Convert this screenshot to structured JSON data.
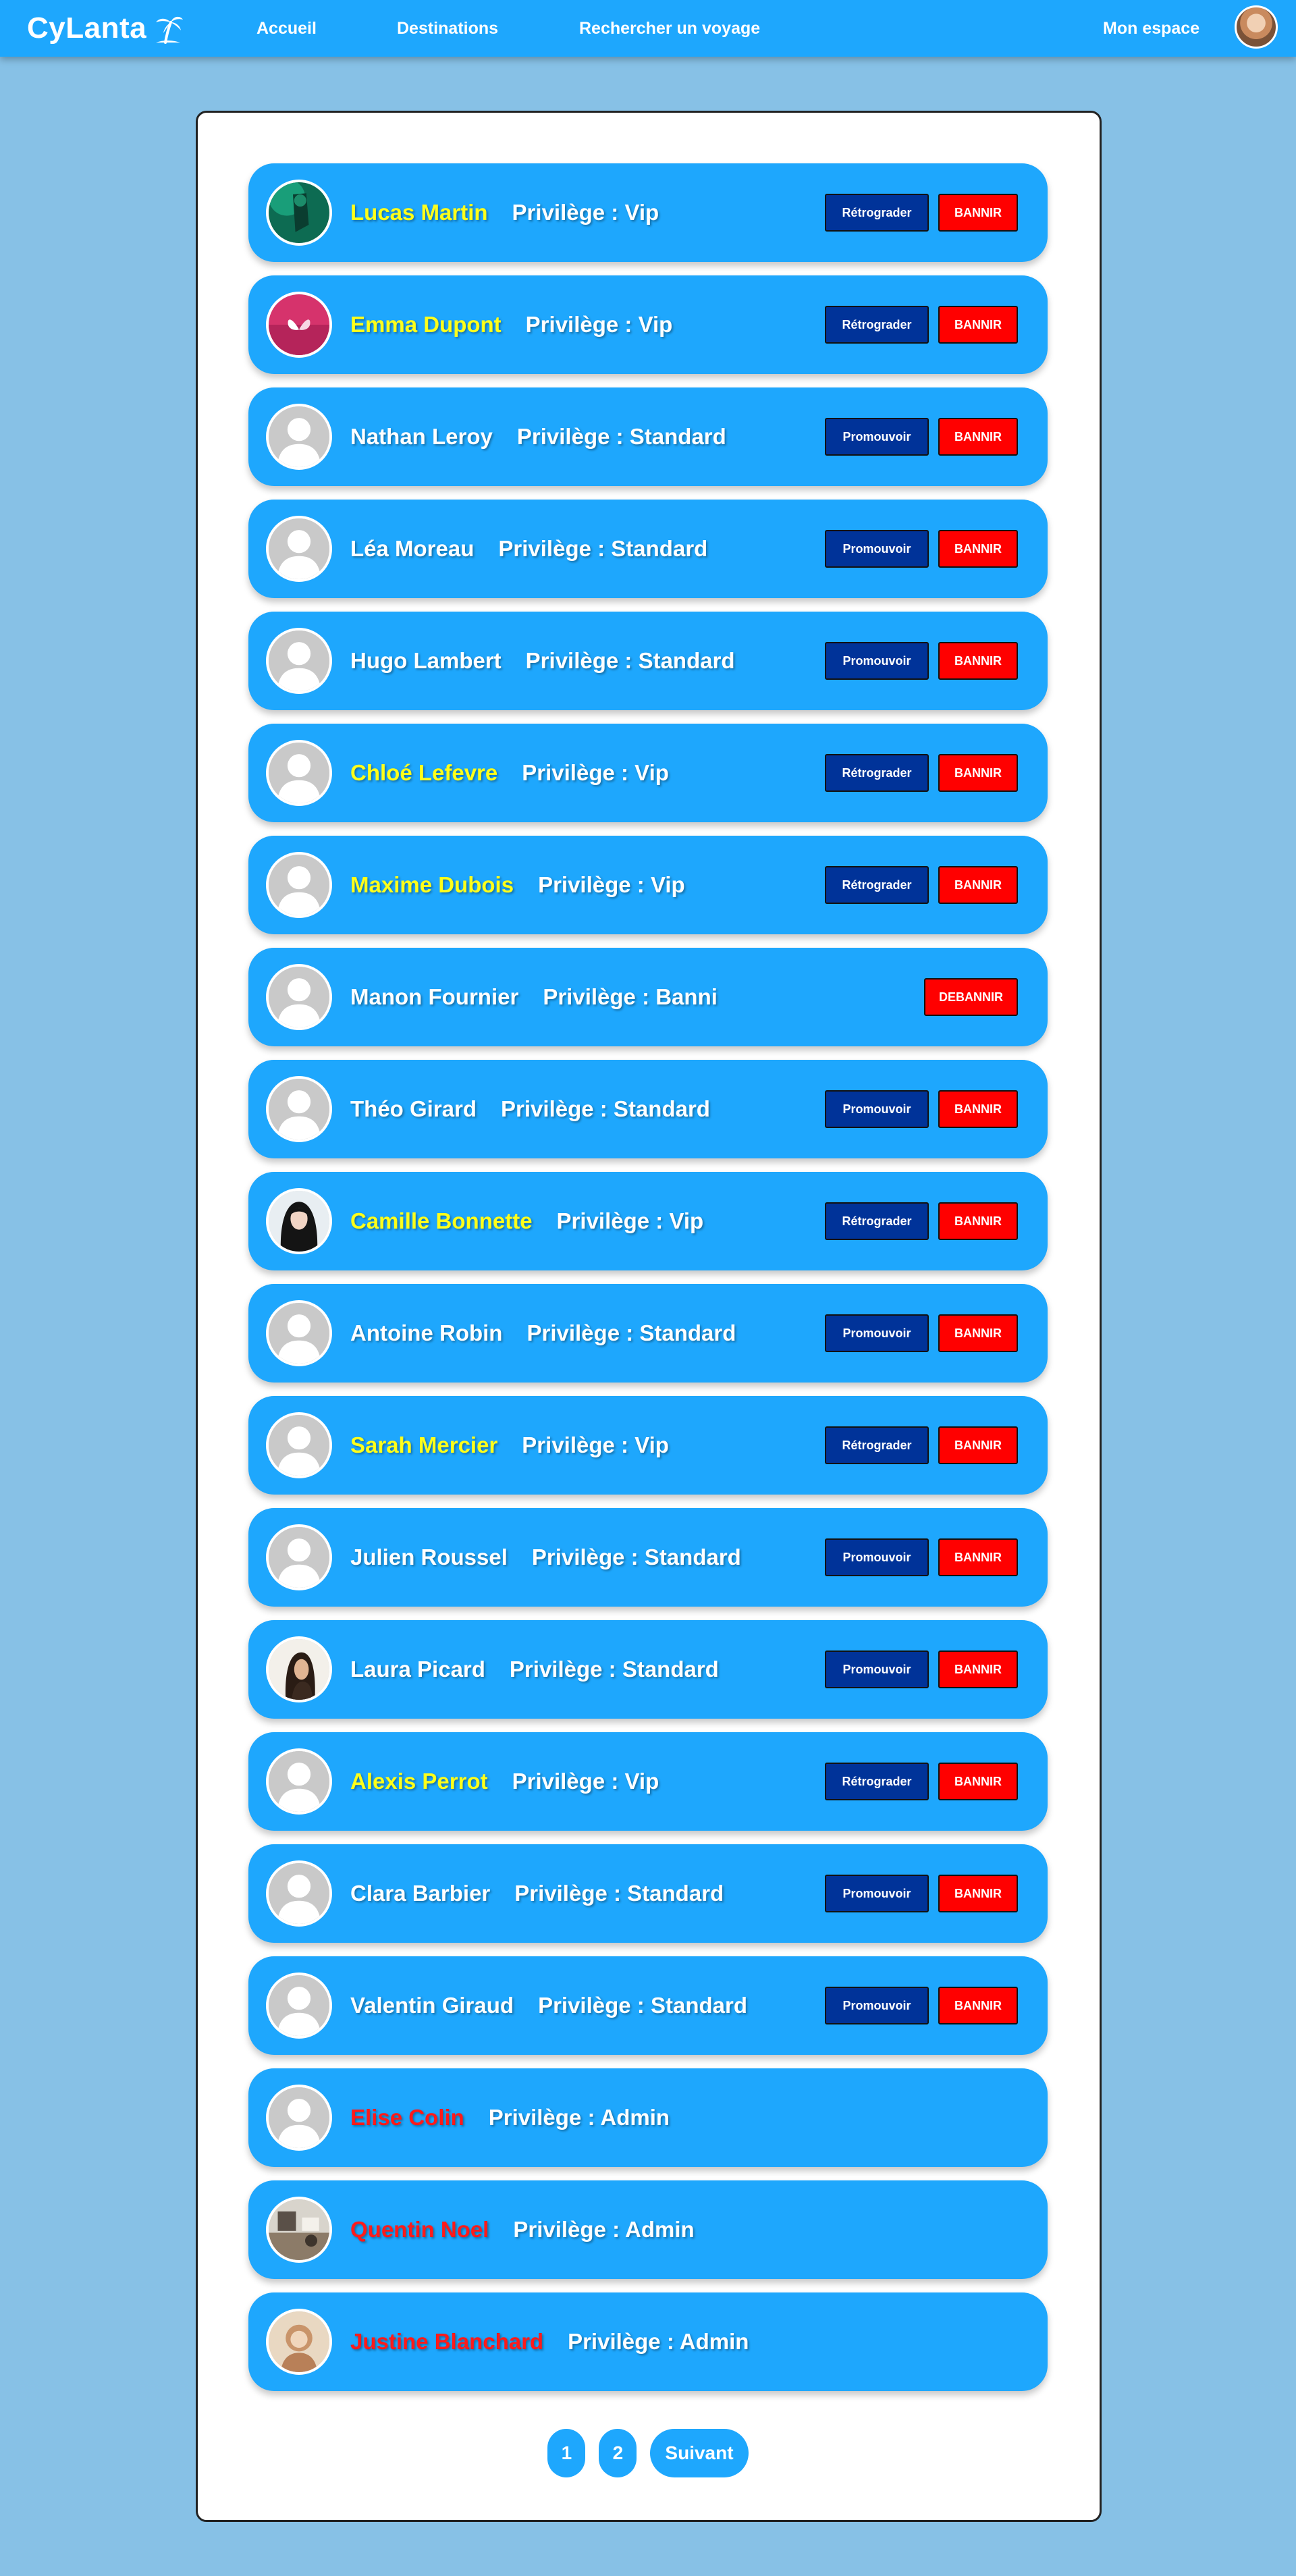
{
  "header": {
    "logo_text": "CyLanta",
    "nav": {
      "home": "Accueil",
      "destinations": "Destinations",
      "search": "Rechercher un voyage",
      "my_space": "Mon espace"
    }
  },
  "users": [
    {
      "name": "Lucas Martin",
      "privilege": "Privilège : Vip",
      "role": "vip",
      "avatar": "photo-green",
      "action": "Rétrograder",
      "ban": "BANNIR"
    },
    {
      "name": "Emma Dupont",
      "privilege": "Privilège : Vip",
      "role": "vip",
      "avatar": "photo-pink",
      "action": "Rétrograder",
      "ban": "BANNIR"
    },
    {
      "name": "Nathan Leroy",
      "privilege": "Privilège : Standard",
      "role": "standard",
      "avatar": "default",
      "action": "Promouvoir",
      "ban": "BANNIR"
    },
    {
      "name": "Léa Moreau",
      "privilege": "Privilège : Standard",
      "role": "standard",
      "avatar": "default",
      "action": "Promouvoir",
      "ban": "BANNIR"
    },
    {
      "name": "Hugo Lambert",
      "privilege": "Privilège : Standard",
      "role": "standard",
      "avatar": "default",
      "action": "Promouvoir",
      "ban": "BANNIR"
    },
    {
      "name": "Chloé Lefevre",
      "privilege": "Privilège : Vip",
      "role": "vip",
      "avatar": "default",
      "action": "Rétrograder",
      "ban": "BANNIR"
    },
    {
      "name": "Maxime Dubois",
      "privilege": "Privilège : Vip",
      "role": "vip",
      "avatar": "default",
      "action": "Rétrograder",
      "ban": "BANNIR"
    },
    {
      "name": "Manon Fournier",
      "privilege": "Privilège : Banni",
      "role": "banned",
      "avatar": "default",
      "action": "",
      "ban": "DEBANNIR"
    },
    {
      "name": "Théo Girard",
      "privilege": "Privilège : Standard",
      "role": "standard",
      "avatar": "default",
      "action": "Promouvoir",
      "ban": "BANNIR"
    },
    {
      "name": "Camille Bonnette",
      "privilege": "Privilège : Vip",
      "role": "vip",
      "avatar": "photo-dark",
      "action": "Rétrograder",
      "ban": "BANNIR"
    },
    {
      "name": "Antoine Robin",
      "privilege": "Privilège : Standard",
      "role": "standard",
      "avatar": "default",
      "action": "Promouvoir",
      "ban": "BANNIR"
    },
    {
      "name": "Sarah Mercier",
      "privilege": "Privilège : Vip",
      "role": "vip",
      "avatar": "default",
      "action": "Rétrograder",
      "ban": "BANNIR"
    },
    {
      "name": "Julien Roussel",
      "privilege": "Privilège : Standard",
      "role": "standard",
      "avatar": "default",
      "action": "Promouvoir",
      "ban": "BANNIR"
    },
    {
      "name": "Laura Picard",
      "privilege": "Privilège : Standard",
      "role": "standard",
      "avatar": "photo-portrait",
      "action": "Promouvoir",
      "ban": "BANNIR"
    },
    {
      "name": "Alexis Perrot",
      "privilege": "Privilège : Vip",
      "role": "vip",
      "avatar": "default",
      "action": "Rétrograder",
      "ban": "BANNIR"
    },
    {
      "name": "Clara Barbier",
      "privilege": "Privilège : Standard",
      "role": "standard",
      "avatar": "default",
      "action": "Promouvoir",
      "ban": "BANNIR"
    },
    {
      "name": "Valentin Giraud",
      "privilege": "Privilège : Standard",
      "role": "standard",
      "avatar": "default",
      "action": "Promouvoir",
      "ban": "BANNIR"
    },
    {
      "name": "Elise Colin",
      "privilege": "Privilège : Admin",
      "role": "admin",
      "avatar": "default",
      "action": "",
      "ban": ""
    },
    {
      "name": "Quentin Noel",
      "privilege": "Privilège : Admin",
      "role": "admin",
      "avatar": "photo-room",
      "action": "",
      "ban": ""
    },
    {
      "name": "Justine Blanchard",
      "privilege": "Privilège : Admin",
      "role": "admin",
      "avatar": "photo-beige",
      "action": "",
      "ban": ""
    }
  ],
  "pagination": {
    "pages": [
      "1",
      "2"
    ],
    "next": "Suivant"
  },
  "colors": {
    "page_background": "#87c1e6",
    "header": "#1ea7fd",
    "row": "#1ea7fd",
    "vip_name": "#ffff1a",
    "admin_name": "#ff1a1a",
    "promote_button": "#003399",
    "ban_button": "#ff0000"
  }
}
